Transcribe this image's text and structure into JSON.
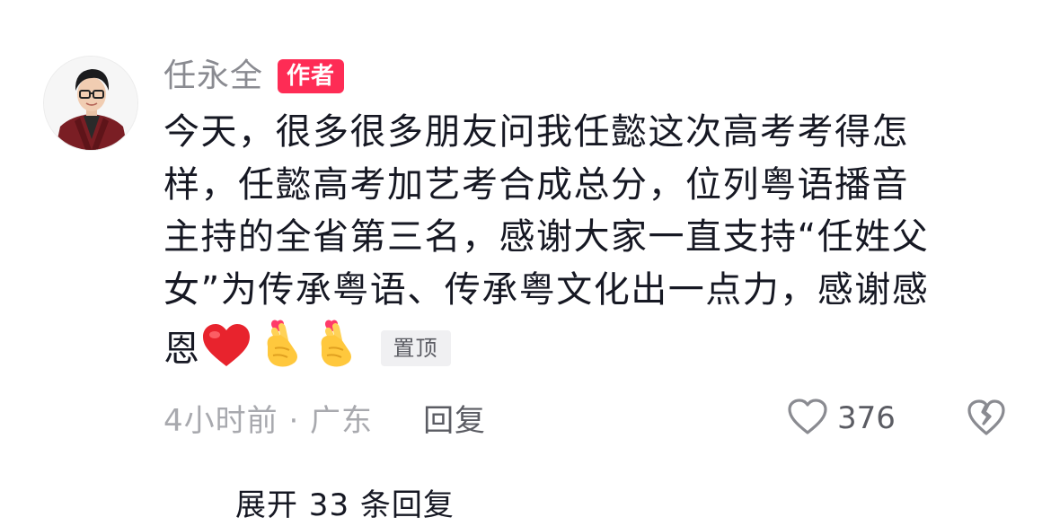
{
  "comment": {
    "username": "任永全",
    "author_badge": "作者",
    "text_line_1": "今天，很多很多朋友问我任懿这次高考考得怎",
    "text_line_2": "样，任懿高考加艺考合成总分，位列粤语播音",
    "text_line_3": "主持的全省第三名，感谢大家一直支持“任姓父",
    "text_line_4": "女”为传承粤语、传承粤文化出一点力，感谢感",
    "text_line_5": "恩",
    "emojis": [
      "red-heart",
      "finger-heart",
      "finger-heart"
    ],
    "pinned_badge": "置顶",
    "time_location": "4小时前 · 广东",
    "reply_label": "回复",
    "like_count": "376",
    "expand_replies_label": "展开 33 条回复"
  },
  "colors": {
    "accent": "#fe2c55",
    "username": "#8a8b91",
    "text": "#161823",
    "meta": "#a8a9ae"
  }
}
